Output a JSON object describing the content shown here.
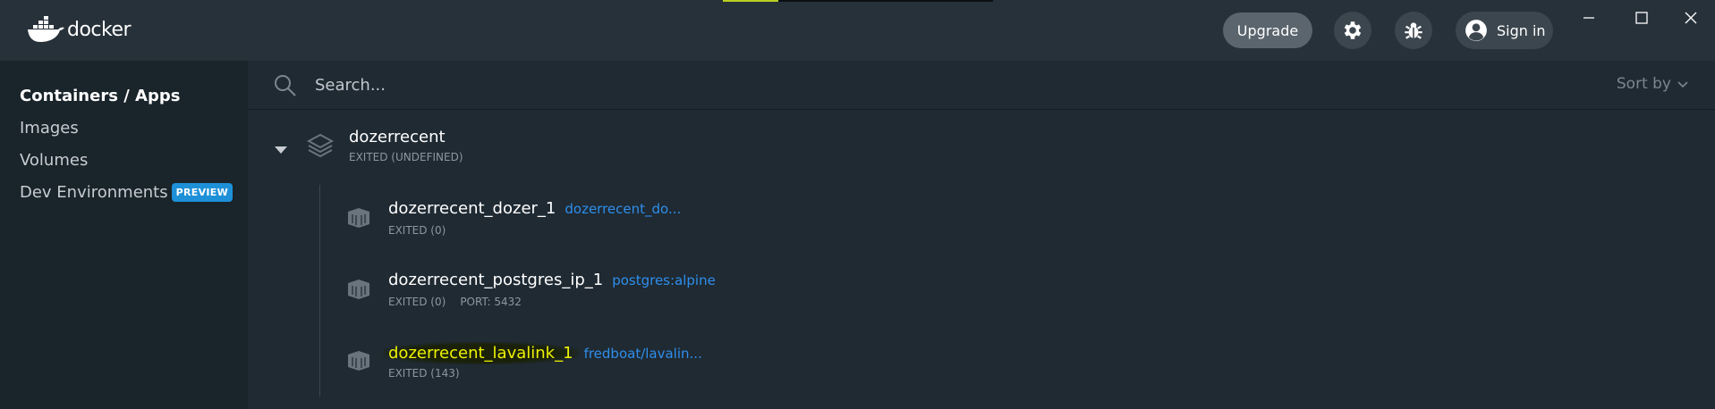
{
  "window": {
    "logo_text": "docker",
    "upgrade_label": "Upgrade",
    "signin_label": "Sign in",
    "icons": {
      "settings": "gear-icon",
      "troubleshoot": "bug-icon",
      "user": "user-icon",
      "minimize": "minimize-icon",
      "maximize": "maximize-icon",
      "close": "close-icon"
    }
  },
  "sidebar": {
    "items": [
      {
        "label": "Containers / Apps",
        "active": true
      },
      {
        "label": "Images",
        "active": false
      },
      {
        "label": "Volumes",
        "active": false
      },
      {
        "label": "Dev Environments",
        "active": false,
        "badge": "PREVIEW"
      }
    ]
  },
  "search": {
    "placeholder": "Search...",
    "value": "",
    "sort_label": "Sort by"
  },
  "app": {
    "name": "dozerrecent",
    "status": "EXITED (UNDEFINED)",
    "containers": [
      {
        "name": "dozerrecent_dozer_1",
        "image": "dozerrecent_do...",
        "status": "EXITED (0)",
        "port": ""
      },
      {
        "name": "dozerrecent_postgres_ip_1",
        "image": "postgres:alpine",
        "status": "EXITED (0)",
        "port": "PORT: 5432"
      },
      {
        "name": "dozerrecent_lavalink_1",
        "image": "fredboat/lavalin...",
        "status": "EXITED (143)",
        "port": "",
        "highlighted": true
      }
    ]
  },
  "colors": {
    "background": "#1f2a33",
    "sidebar": "#1a242b",
    "accent_link": "#2f8eeb",
    "badge": "#1e90d8",
    "highlight_text": "#eef200"
  }
}
